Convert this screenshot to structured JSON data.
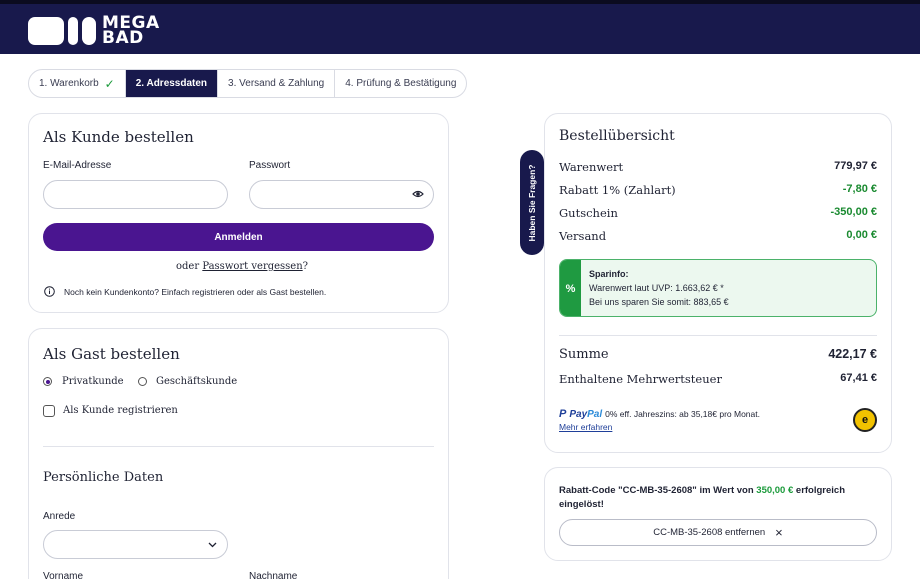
{
  "brand": {
    "logo_line1": "MEGA",
    "logo_line2": "BAD"
  },
  "stepper": [
    {
      "label": "1. Warenkorb",
      "state": "done"
    },
    {
      "label": "2. Adressdaten",
      "state": "active"
    },
    {
      "label": "3. Versand & Zahlung",
      "state": "pending"
    },
    {
      "label": "4. Prüfung & Bestätigung",
      "state": "pending"
    }
  ],
  "login": {
    "title": "Als Kunde bestellen",
    "email_label": "E-Mail-Adresse",
    "email_value": "",
    "password_label": "Passwort",
    "password_value": "",
    "submit_label": "Anmelden",
    "or_text": "oder",
    "forgot_link": "Passwort vergessen",
    "forgot_suffix": "?",
    "info_text": "Noch kein Kundenkonto? Einfach registrieren oder als Gast bestellen."
  },
  "guest": {
    "title": "Als Gast bestellen",
    "radio_private": "Privatkunde",
    "radio_business": "Geschäftskunde",
    "selected": "private",
    "register_label": "Als Kunde registrieren",
    "personal_title": "Persönliche Daten",
    "salutation_label": "Anrede",
    "salutation_value": "",
    "firstname_label": "Vorname",
    "lastname_label": "Nachname"
  },
  "side_tab": "Haben Sie Fragen?",
  "summary": {
    "title": "Bestellübersicht",
    "rows": [
      {
        "label": "Warenwert",
        "value": "779,97 €",
        "highlight": false
      },
      {
        "label": "Rabatt 1% (Zahlart)",
        "value": "-7,80 €",
        "highlight": true
      },
      {
        "label": "Gutschein",
        "value": "-350,00 €",
        "highlight": true
      },
      {
        "label": "Versand",
        "value": "0,00 €",
        "highlight": true
      }
    ],
    "spar": {
      "symbol": "%",
      "title": "Sparinfo:",
      "line1": "Warenwert laut UVP: 1.663,62 € *",
      "line2": "Bei uns sparen Sie somit: 883,65 €"
    },
    "total_label": "Summe",
    "total_value": "422,17 €",
    "tax_label": "Enthaltene Mehrwertsteuer",
    "tax_value": "67,41 €",
    "paypal_brand_a": "Pay",
    "paypal_brand_b": "Pal",
    "paypal_text": "0% eff. Jahreszins: ab 35,18€ pro Monat.",
    "paypal_link": "Mehr erfahren",
    "seal_symbol": "e"
  },
  "coupon": {
    "text_before": "Rabatt-Code \"CC-MB-35-2608\" im Wert von ",
    "amount": "350,00 €",
    "text_after": " erfolgreich eingelöst!",
    "remove_label": "CC-MB-35-2608 entfernen",
    "remove_icon": "×"
  },
  "colors": {
    "navy": "#18194c",
    "purple": "#4a1590",
    "green": "#1a8a30",
    "amount_green": "#1a9a3a"
  }
}
